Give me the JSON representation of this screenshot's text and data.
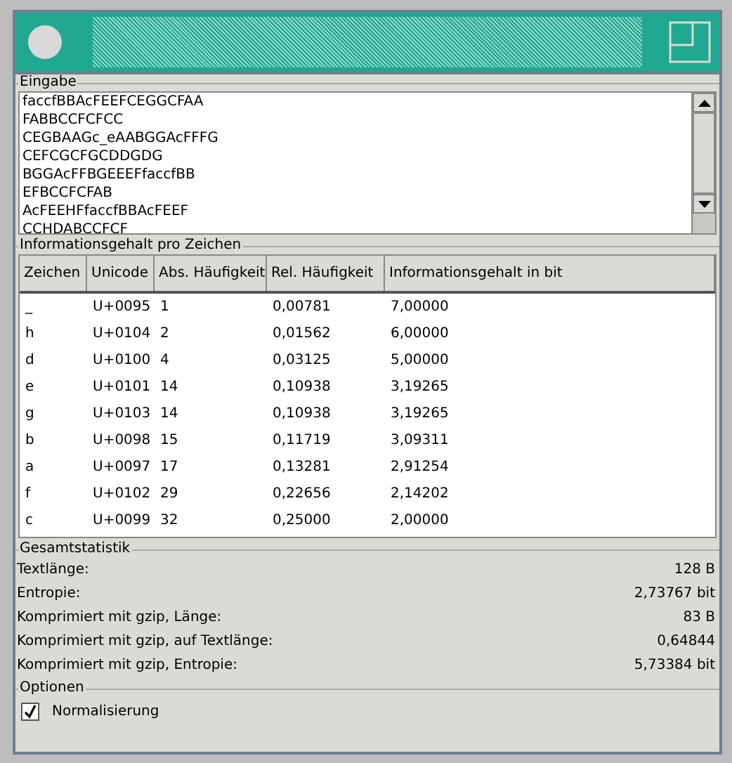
{
  "input": {
    "title": "Eingabe",
    "lines": [
      "faccfBBAcFEEFCEGGCFAA",
      "FABBCCFCFCC",
      "CEGBAAGc_eAABGGAcFFFG",
      "CEFCGCFGCDDGDG",
      "BGGAcFFBGEEEFfaccfBB",
      "EFBCCFCFAB",
      "AcFEEHFfaccfBBAcFEEF",
      "CCHDABCCFCF"
    ]
  },
  "info": {
    "title": "Informationsgehalt pro Zeichen",
    "columns": [
      "Zeichen",
      "Unicode",
      "Abs. Häufigkeit",
      "Rel. Häufigkeit",
      "Informationsgehalt in bit"
    ],
    "rows": [
      [
        "_",
        "U+0095",
        "1",
        "0,00781",
        "7,00000"
      ],
      [
        "h",
        "U+0104",
        "2",
        "0,01562",
        "6,00000"
      ],
      [
        "d",
        "U+0100",
        "4",
        "0,03125",
        "5,00000"
      ],
      [
        "e",
        "U+0101",
        "14",
        "0,10938",
        "3,19265"
      ],
      [
        "g",
        "U+0103",
        "14",
        "0,10938",
        "3,19265"
      ],
      [
        "b",
        "U+0098",
        "15",
        "0,11719",
        "3,09311"
      ],
      [
        "a",
        "U+0097",
        "17",
        "0,13281",
        "2,91254"
      ],
      [
        "f",
        "U+0102",
        "29",
        "0,22656",
        "2,14202"
      ],
      [
        "c",
        "U+0099",
        "32",
        "0,25000",
        "2,00000"
      ]
    ]
  },
  "stats": {
    "title": "Gesamtstatistik",
    "rows": [
      {
        "label": "Textlänge:",
        "value": "128 B"
      },
      {
        "label": "Entropie:",
        "value": "2,73767 bit"
      },
      {
        "label": "Komprimiert mit gzip, Länge:",
        "value": "83 B"
      },
      {
        "label": "Komprimiert mit gzip, auf Textlänge:",
        "value": "0,64844"
      },
      {
        "label": "Komprimiert mit gzip, Entropie:",
        "value": "5,73384 bit"
      }
    ]
  },
  "options": {
    "title": "Optionen",
    "items": [
      {
        "label": "Normalisierung",
        "checked": true
      }
    ]
  }
}
